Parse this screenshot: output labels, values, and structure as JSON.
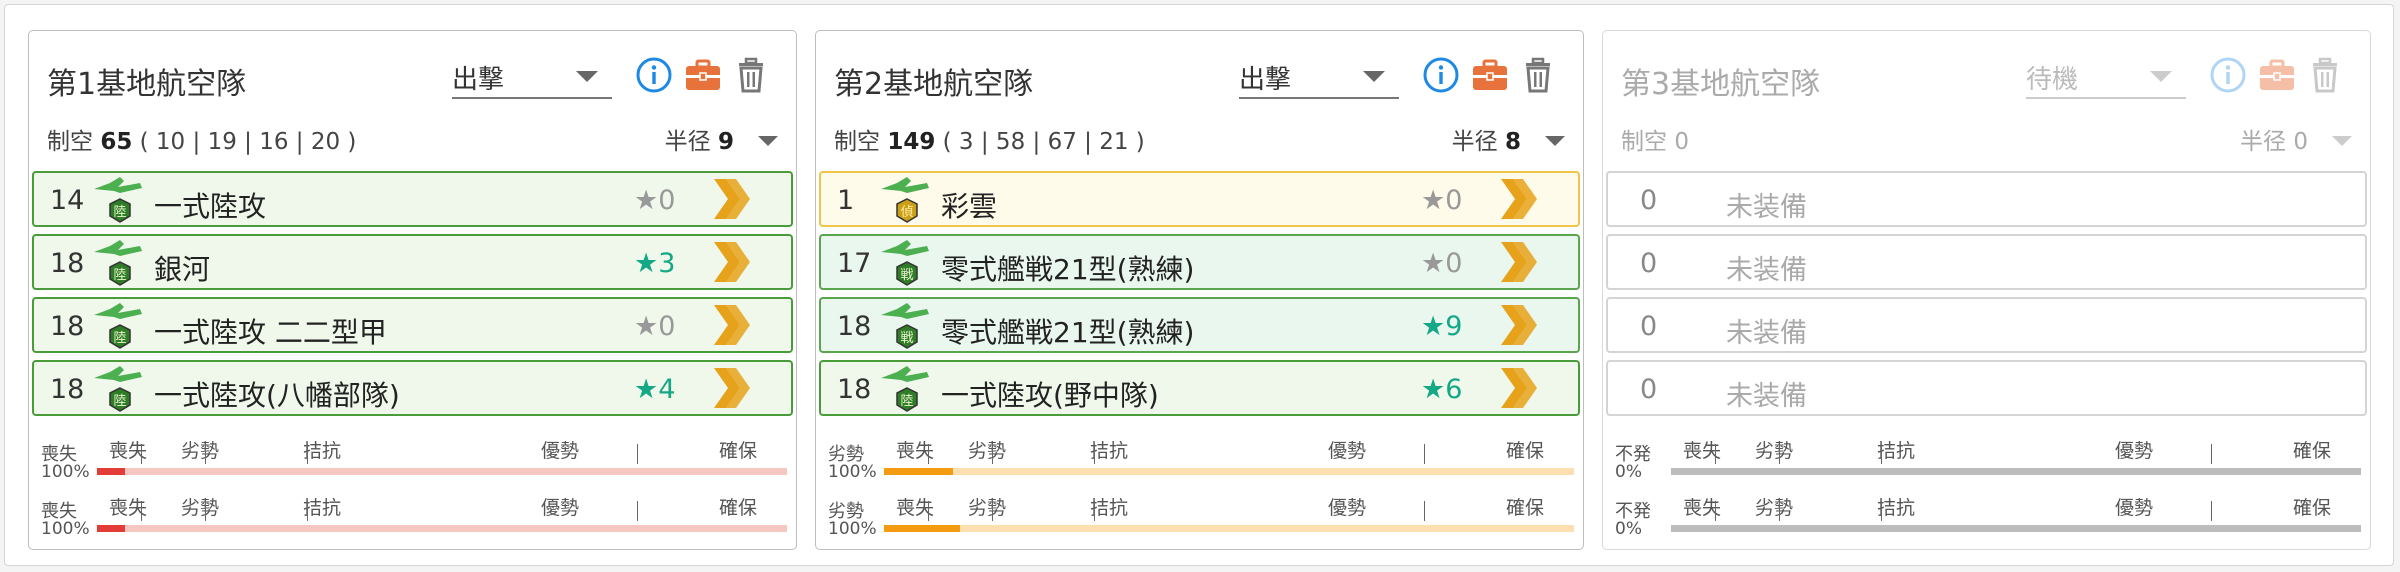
{
  "colors": {
    "info": "#1e88e5",
    "briefcase": "#e8723c",
    "trash": "#777777",
    "land_green": "#2f7d26",
    "recon_gold": "#c9a017",
    "level_teal": "#14a886",
    "chevron": "#e6a21a",
    "red_fill": "#e33b35",
    "red_track": "#f6c6c2",
    "orange_fill": "#f39c12",
    "orange_track": "#fde0b2",
    "gray_track": "#bdbdbd"
  },
  "scale_labels": [
    "喪失",
    "劣勢",
    "拮抗",
    "優勢",
    "確保"
  ],
  "panels": [
    {
      "title": "第1基地航空隊",
      "mode": "出撃",
      "stats_label": "制空",
      "air_power": "65",
      "detail": "( 10 | 19 | 16 | 20 )",
      "radius_label": "半径",
      "radius": "9",
      "disabled": false,
      "rows": [
        {
          "count": "14",
          "icon": "land-attacker-icon",
          "badge": "陸",
          "name": "一式陸攻",
          "star": "★0",
          "level": false
        },
        {
          "count": "18",
          "icon": "land-attacker-icon",
          "badge": "陸",
          "name": "銀河",
          "star": "★3",
          "level": true
        },
        {
          "count": "18",
          "icon": "land-attacker-icon",
          "badge": "陸",
          "name": "一式陸攻 二二型甲",
          "star": "★0",
          "level": false
        },
        {
          "count": "18",
          "icon": "land-attacker-icon",
          "badge": "陸",
          "name": "一式陸攻(八幡部隊)",
          "star": "★4",
          "level": true
        }
      ],
      "bars": [
        {
          "status": "喪失",
          "percent": "100%",
          "fill": 0.04,
          "fill_color": "#e33b35",
          "track_color": "#f6c6c2"
        },
        {
          "status": "喪失",
          "percent": "100%",
          "fill": 0.04,
          "fill_color": "#e33b35",
          "track_color": "#f6c6c2"
        }
      ]
    },
    {
      "title": "第2基地航空隊",
      "mode": "出撃",
      "stats_label": "制空",
      "air_power": "149",
      "detail": "( 3 | 58 | 67 | 21 )",
      "radius_label": "半径",
      "radius": "8",
      "disabled": false,
      "rows": [
        {
          "count": "1",
          "icon": "recon-plane-icon",
          "badge": "偵",
          "name": "彩雲",
          "star": "★0",
          "level": false,
          "kind": "recon"
        },
        {
          "count": "17",
          "icon": "fighter-plane-icon",
          "badge": "戦",
          "name": "零式艦戦21型(熟練)",
          "star": "★0",
          "level": false,
          "kind": "fighter"
        },
        {
          "count": "18",
          "icon": "fighter-plane-icon",
          "badge": "戦",
          "name": "零式艦戦21型(熟練)",
          "star": "★9",
          "level": true,
          "kind": "fighter"
        },
        {
          "count": "18",
          "icon": "land-attacker-icon",
          "badge": "陸",
          "name": "一式陸攻(野中隊)",
          "star": "★6",
          "level": true
        }
      ],
      "bars": [
        {
          "status": "劣勢",
          "percent": "100%",
          "fill": 0.1,
          "fill_color": "#f39c12",
          "track_color": "#fde0b2"
        },
        {
          "status": "劣勢",
          "percent": "100%",
          "fill": 0.11,
          "fill_color": "#f39c12",
          "track_color": "#fde0b2"
        }
      ]
    },
    {
      "title": "第3基地航空隊",
      "mode": "待機",
      "stats_label": "制空",
      "air_power": "0",
      "detail": "",
      "radius_label": "半径",
      "radius": "0",
      "disabled": true,
      "rows": [
        {
          "count": "0",
          "name": "未装備",
          "empty": true
        },
        {
          "count": "0",
          "name": "未装備",
          "empty": true
        },
        {
          "count": "0",
          "name": "未装備",
          "empty": true
        },
        {
          "count": "0",
          "name": "未装備",
          "empty": true
        }
      ],
      "bars": [
        {
          "status": "不発",
          "percent": "0%",
          "fill": 0,
          "fill_color": "#bdbdbd",
          "track_color": "#bdbdbd"
        },
        {
          "status": "不発",
          "percent": "0%",
          "fill": 0,
          "fill_color": "#bdbdbd",
          "track_color": "#bdbdbd"
        }
      ]
    }
  ]
}
